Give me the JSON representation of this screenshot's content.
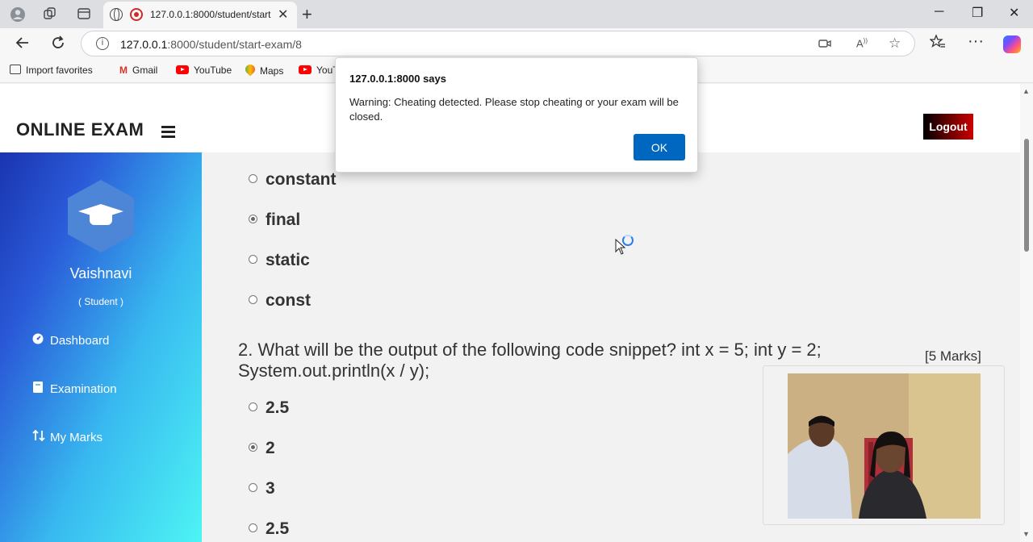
{
  "browser": {
    "tab_title": "127.0.0.1:8000/student/start-exam/8",
    "url_host": "127.0.0.1",
    "url_rest": ":8000/student/start-exam/8",
    "favorites": [
      {
        "label": "Import favorites"
      },
      {
        "label": "Gmail"
      },
      {
        "label": "YouTube"
      },
      {
        "label": "Maps"
      },
      {
        "label": "YouT"
      }
    ]
  },
  "header": {
    "brand": "ONLINE EXAM",
    "logout_label": "Logout"
  },
  "sidebar": {
    "user_name": "Vaishnavi",
    "user_role": "( Student )",
    "items": [
      {
        "label": "Dashboard",
        "icon": "dashboard-icon"
      },
      {
        "label": "Examination",
        "icon": "book-icon"
      },
      {
        "label": "My Marks",
        "icon": "sort-icon"
      }
    ]
  },
  "exam": {
    "question1_options": [
      {
        "label": "constant",
        "selected": false
      },
      {
        "label": "final",
        "selected": true
      },
      {
        "label": "static",
        "selected": false
      },
      {
        "label": "const",
        "selected": false
      }
    ],
    "question2": {
      "text": "2. What will be the output of the following code snippet? int x = 5; int y = 2; System.out.println(x / y);",
      "marks": "[5 Marks]",
      "options": [
        {
          "label": "2.5",
          "selected": false
        },
        {
          "label": "2",
          "selected": true
        },
        {
          "label": "3",
          "selected": false
        },
        {
          "label": "2.5",
          "selected": false
        }
      ]
    }
  },
  "dialog": {
    "title": "127.0.0.1:8000 says",
    "message": "Warning: Cheating detected. Please stop cheating or your exam will be closed.",
    "ok_label": "OK"
  },
  "colors": {
    "dialog_button": "#0067c0",
    "sidebar_start": "#1a34b0",
    "sidebar_end": "#4df4f4",
    "logout_bg": "#7a0000"
  }
}
